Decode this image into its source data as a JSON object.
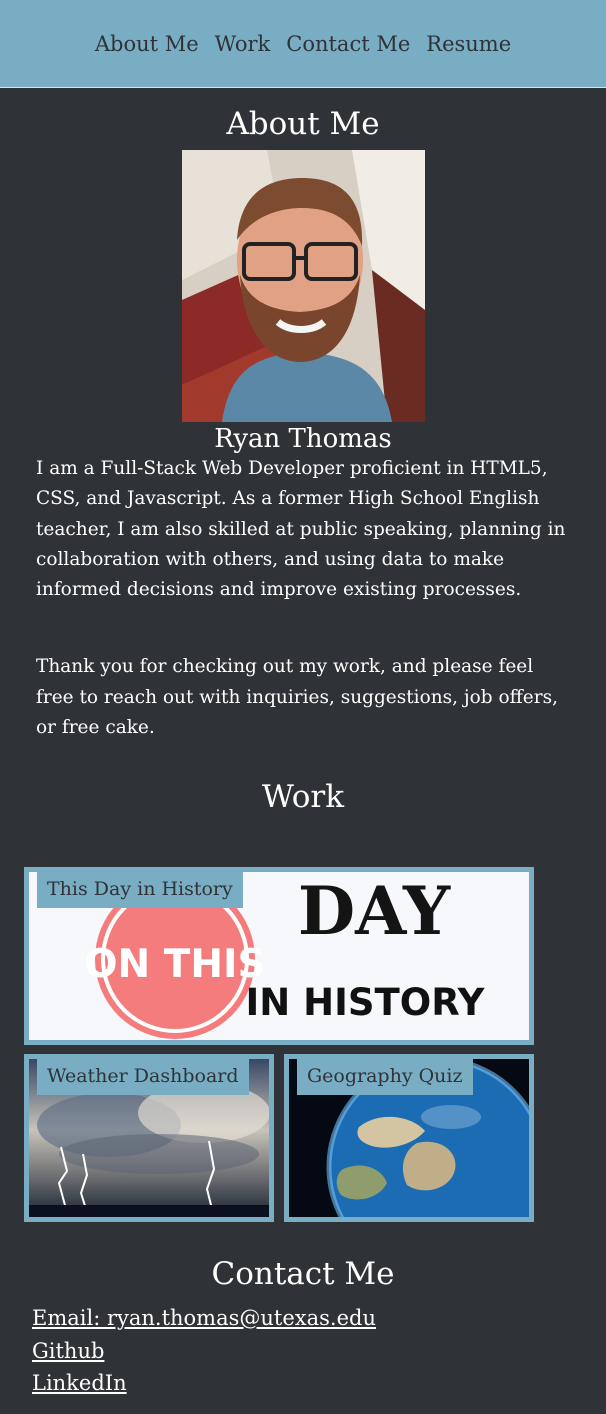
{
  "nav": {
    "items": [
      "About Me",
      "Work",
      "Contact Me",
      "Resume"
    ]
  },
  "about": {
    "title": "About Me",
    "name": "Ryan Thomas",
    "paragraphs": [
      "I am a Full-Stack Web Developer proficient in HTML5, CSS, and Javascript. As a former High School English teacher, I am also skilled at public speaking, planning in collaboration with others, and using data to make informed decisions and improve existing processes.",
      "Thank you for checking out my work, and please feel free to reach out with inquiries, suggestions, job offers, or free cake."
    ]
  },
  "work": {
    "title": "Work",
    "projects": [
      {
        "label": "This Day in History",
        "logo_left": "ON THIS",
        "logo_right_top": "DAY",
        "logo_right_bottom": "IN HISTORY"
      },
      {
        "label": "Weather Dashboard"
      },
      {
        "label": "Geography Quiz"
      }
    ]
  },
  "contact": {
    "title": "Contact Me",
    "links": [
      "Email: ryan.thomas@utexas.edu",
      "Github",
      "LinkedIn"
    ]
  },
  "colors": {
    "accent": "#79adc4",
    "background": "#2f3237",
    "text": "#ffffff"
  }
}
